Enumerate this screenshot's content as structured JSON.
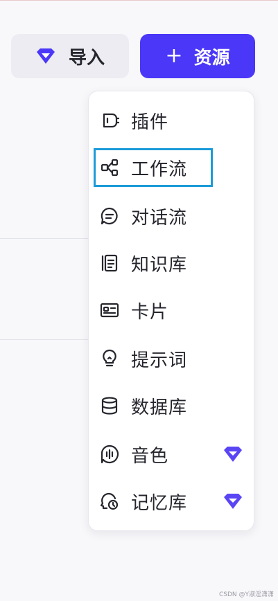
{
  "toolbar": {
    "import_label": "导入",
    "resource_label": "资源",
    "resource_plus": "+"
  },
  "colors": {
    "accent": "#4a37f7",
    "selection_outline": "#1b9bd8",
    "premium_gem": "#5a45f5"
  },
  "menu": {
    "items": [
      {
        "label": "插件",
        "icon": "plugin-icon",
        "premium": false
      },
      {
        "label": "工作流",
        "icon": "workflow-icon",
        "premium": false,
        "selected": true
      },
      {
        "label": "对话流",
        "icon": "chatflow-icon",
        "premium": false
      },
      {
        "label": "知识库",
        "icon": "knowledge-icon",
        "premium": false
      },
      {
        "label": "卡片",
        "icon": "card-icon",
        "premium": false
      },
      {
        "label": "提示词",
        "icon": "prompt-icon",
        "premium": false
      },
      {
        "label": "数据库",
        "icon": "database-icon",
        "premium": false
      },
      {
        "label": "音色",
        "icon": "voice-icon",
        "premium": true
      },
      {
        "label": "记忆库",
        "icon": "memory-icon",
        "premium": true
      }
    ]
  },
  "watermark": "CSDN @Y淑淫潇潇"
}
